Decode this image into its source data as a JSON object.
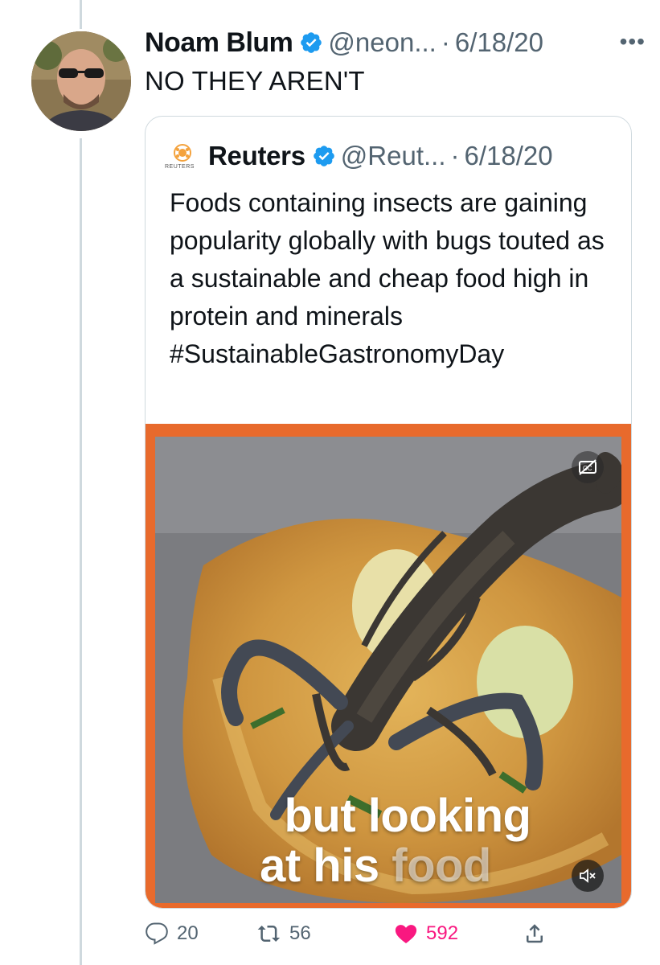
{
  "tweet": {
    "author_name": "Noam Blum",
    "handle": "@neon...",
    "separator": "·",
    "date": "6/18/20",
    "text": "NO THEY AREN'T",
    "more_icon": "more-horizontal-icon"
  },
  "quoted_tweet": {
    "author_name": "Reuters",
    "handle": "@Reut...",
    "separator": "·",
    "date": "6/18/20",
    "logo_text": "REUTERS",
    "text": "Foods containing insects are gaining popularity globally with bugs touted as a sustainable and cheap food high in protein and minerals #SustainableGastronomyDay",
    "media": {
      "caption_line1": "but looking",
      "caption_line2_a": "at his",
      "caption_line2_b": "food",
      "cc_icon": "closed-captions-icon",
      "mute_icon": "muted-speaker-icon",
      "frame_color": "#e86a2c"
    }
  },
  "actions": {
    "replies": "20",
    "retweets": "56",
    "likes": "592",
    "liked": true,
    "like_color": "#f91880"
  },
  "colors": {
    "verified": "#1d9bf0",
    "secondary_text": "#536471",
    "border": "#cfd9de"
  }
}
